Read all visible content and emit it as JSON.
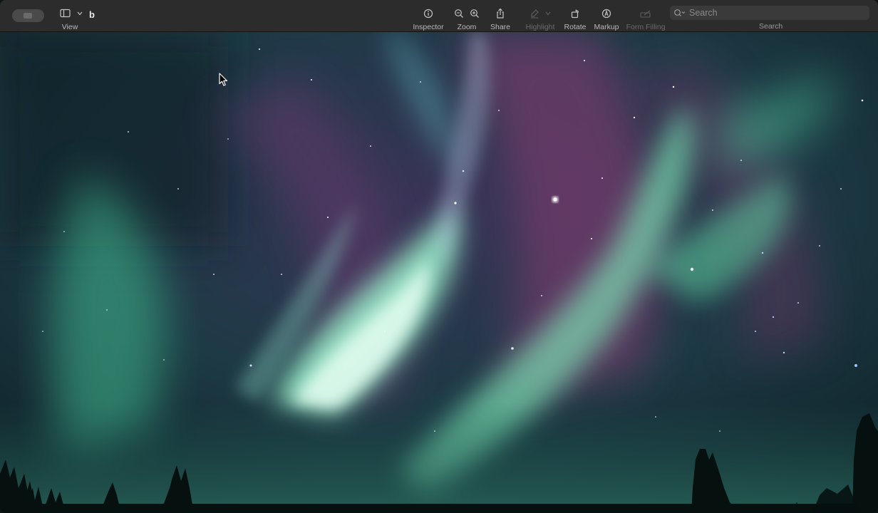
{
  "window": {
    "document_title": "b"
  },
  "toolbar": {
    "view_label": "View",
    "inspector_label": "Inspector",
    "zoom_label": "Zoom",
    "share_label": "Share",
    "highlight_label": "Highlight",
    "rotate_label": "Rotate",
    "markup_label": "Markup",
    "form_filling_label": "Form Filling",
    "search_placeholder": "Search",
    "search_label": "Search"
  },
  "image": {
    "subject": "aurora borealis over spruce silhouettes"
  },
  "colors": {
    "toolbar_bg": "#2c2c2c",
    "aurora_green": "#7fe8b8",
    "aurora_magenta": "#8a3c74",
    "sky_dark": "#0d1518"
  }
}
